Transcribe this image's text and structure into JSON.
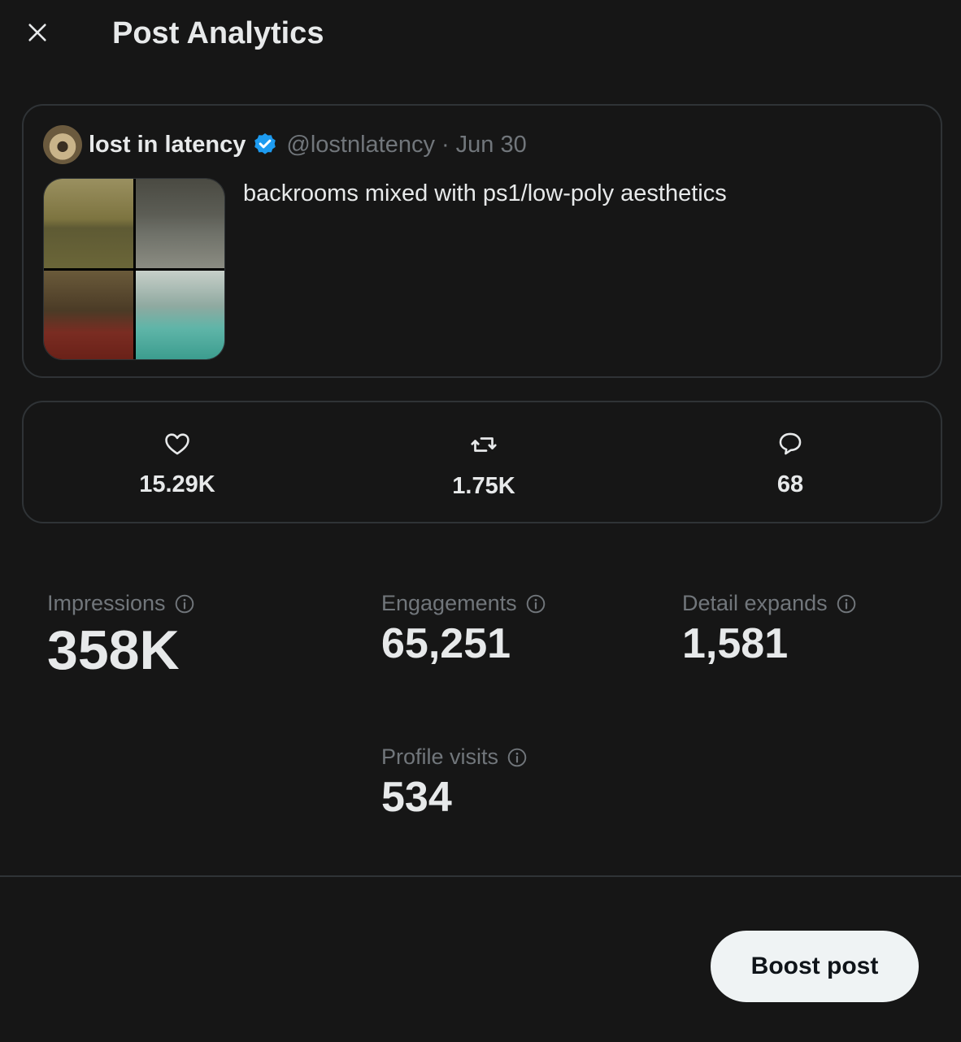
{
  "header": {
    "title": "Post Analytics",
    "close_icon": "close-icon"
  },
  "post": {
    "author_name": "lost in latency",
    "verified_icon": "verified-badge-icon",
    "verified_color": "#1d9bf0",
    "handle": "@lostnlatency",
    "separator": "·",
    "date": "Jun 30",
    "text": "backrooms mixed with ps1/low-poly aesthetics",
    "media_count": 4
  },
  "engagement": [
    {
      "icon": "heart-icon",
      "count": "15.29K"
    },
    {
      "icon": "repost-icon",
      "count": "1.75K"
    },
    {
      "icon": "reply-icon",
      "count": "68"
    }
  ],
  "metrics": {
    "impressions": {
      "label": "Impressions",
      "value": "358K"
    },
    "engagements": {
      "label": "Engagements",
      "value": "65,251"
    },
    "detail_expands": {
      "label": "Detail expands",
      "value": "1,581"
    },
    "profile_visits": {
      "label": "Profile visits",
      "value": "534"
    }
  },
  "footer": {
    "boost_label": "Boost post"
  },
  "colors": {
    "background": "#161616",
    "text_primary": "#e7e9ea",
    "text_secondary": "#71767b",
    "border": "#2f3336",
    "button_bg": "#eff3f4"
  }
}
